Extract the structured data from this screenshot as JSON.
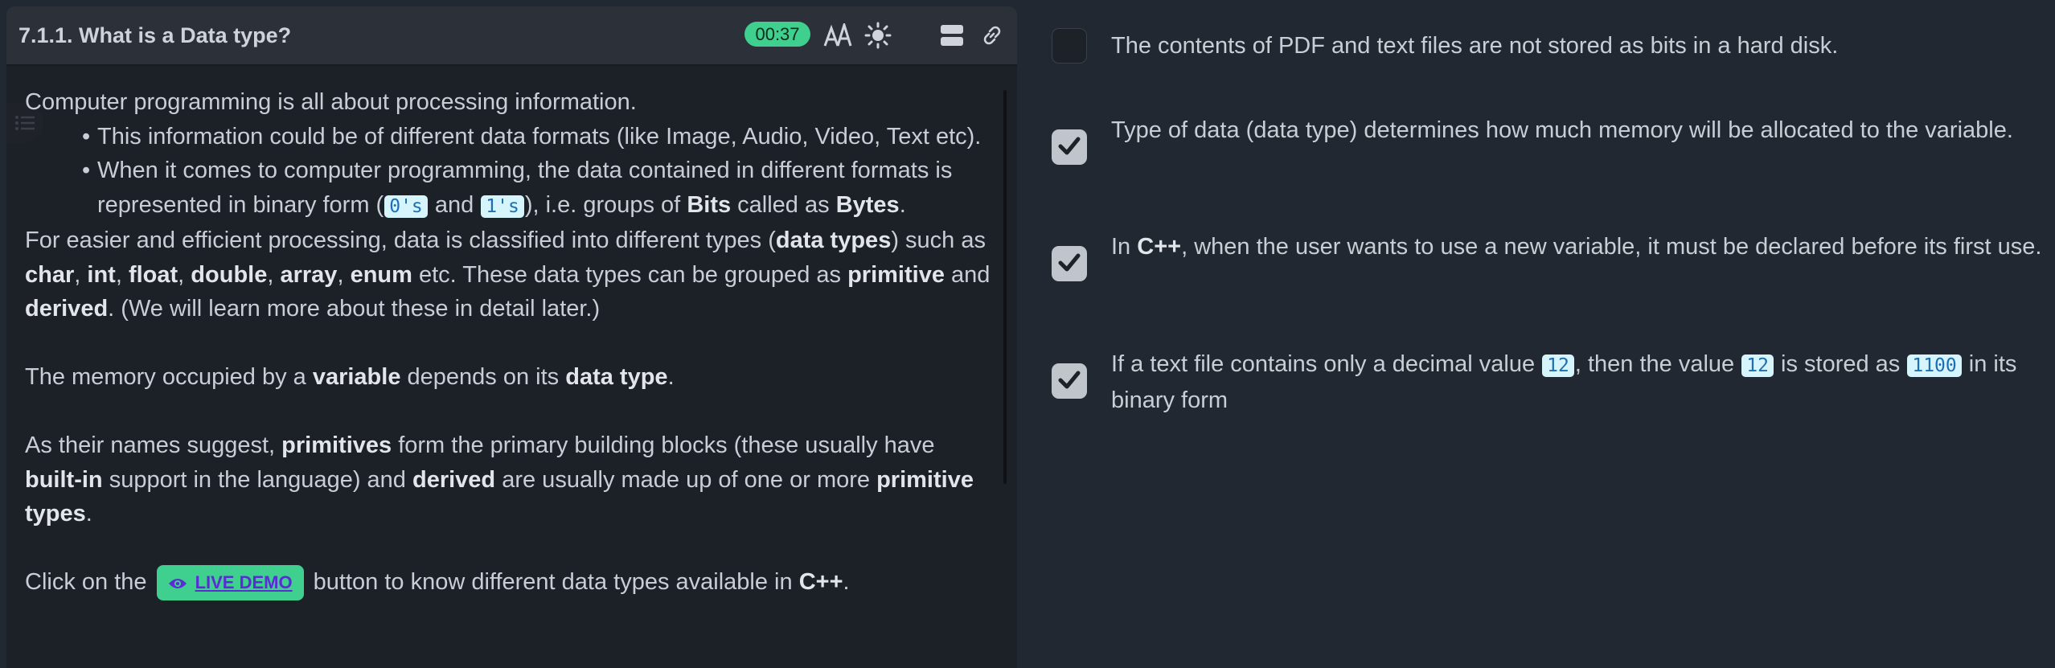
{
  "lesson": {
    "title": "7.1.1. What is a Data type?",
    "timer": "00:37",
    "intro": "Computer programming is all about processing information.",
    "bullet1": "This information could be of different data formats (like Image, Audio, Video, Text etc).",
    "bullet2": {
      "p1": "When it comes to computer programming, the data contained in different formats is represented in binary form (",
      "code1": "0's",
      "p2": " and ",
      "code2": "1's",
      "p3": "), i.e. groups of ",
      "b1": "Bits",
      "p4": " called as ",
      "b2": "Bytes",
      "p5": "."
    },
    "para1": {
      "p1": "For easier and efficient processing, data is classified into different types (",
      "b1": "data types",
      "p2": ") such as ",
      "b2": "char",
      "p3": ", ",
      "b3": "int",
      "p4": ", ",
      "b4": "float",
      "p5": ", ",
      "b5": "double",
      "p6": ", ",
      "b6": "array",
      "p7": ", ",
      "b7": "enum",
      "p8": " etc. These data types can be grouped as ",
      "b8": "primitive",
      "p9": " and ",
      "b9": "derived",
      "p10": ". (We will learn more about these in detail later.)"
    },
    "para2": {
      "p1": "The memory occupied by a ",
      "b1": "variable",
      "p2": " depends on its ",
      "b2": "data type",
      "p3": "."
    },
    "para3": {
      "p1": "As their names suggest, ",
      "b1": "primitives",
      "p2": " form the primary building blocks (these usually have ",
      "b2": "built-in",
      "p3": " support in the language) and ",
      "b3": "derived",
      "p4": " are usually made up of one or more ",
      "b4": "primitive types",
      "p5": "."
    },
    "para4": {
      "p1": "Click on the ",
      "button": "LIVE DEMO",
      "p2": " button to know different data types available in ",
      "b1": "C++",
      "p3": "."
    }
  },
  "questions": [
    {
      "checked": false,
      "text": "The contents of PDF and text files are not stored as bits in a hard disk."
    },
    {
      "checked": true,
      "text": "Type of data (data type) determines how much memory will be allocated to the variable."
    },
    {
      "checked": true,
      "p1": "In ",
      "b1": "C++",
      "p2": ", when the user wants to use a new variable, it must be declared before its first use."
    },
    {
      "checked": true,
      "p1": "If a text file contains only a decimal value ",
      "code1": "12",
      "p2": ", then the value ",
      "code2": "12",
      "p3": " is stored as ",
      "code3": "1100",
      "p4": " in its binary form"
    }
  ],
  "colors": {
    "timer_bg": "#3fcf8e",
    "code_bg": "#d6f4fb",
    "code_fg": "#1d6fb3",
    "button_bg": "#3fcf8e",
    "button_fg": "#5b2bd6"
  },
  "icons": {
    "font_size": "font-size-icon",
    "theme": "sun-icon",
    "layout": "layout-icon",
    "link": "link-icon",
    "toc": "list-icon",
    "demo": "eye-icon",
    "check": "check-icon"
  }
}
